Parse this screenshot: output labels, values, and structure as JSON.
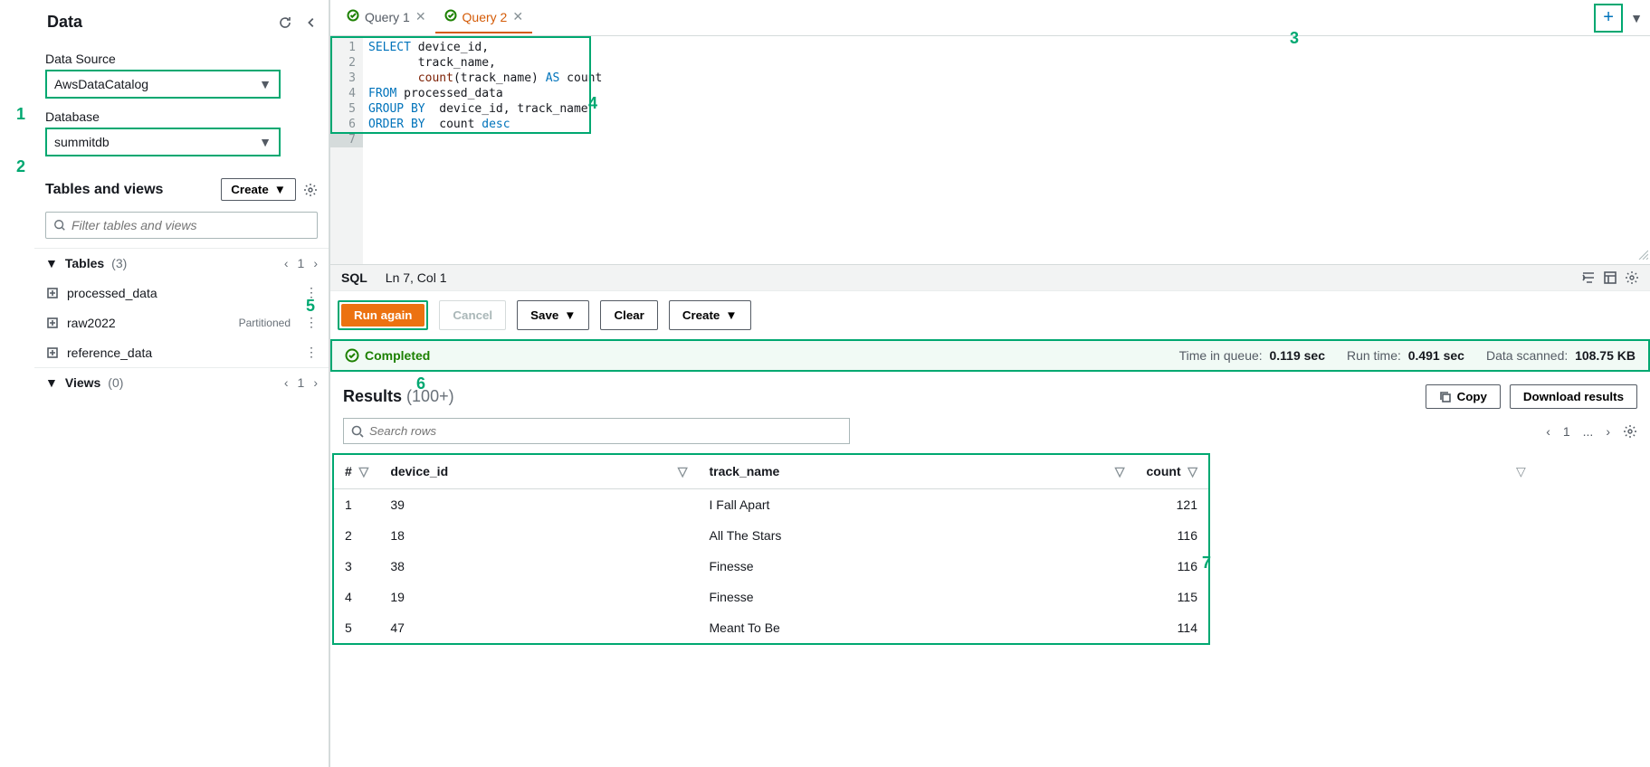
{
  "sidebar": {
    "title": "Data",
    "data_source_label": "Data Source",
    "data_source_value": "AwsDataCatalog",
    "database_label": "Database",
    "database_value": "summitdb",
    "tables_views_title": "Tables and views",
    "create_label": "Create",
    "filter_placeholder": "Filter tables and views",
    "tables_label": "Tables",
    "tables_count": "(3)",
    "tables_page": "1",
    "tables": [
      {
        "name": "processed_data",
        "badge": ""
      },
      {
        "name": "raw2022",
        "badge": "Partitioned"
      },
      {
        "name": "reference_data",
        "badge": ""
      }
    ],
    "views_label": "Views",
    "views_count": "(0)",
    "views_page": "1"
  },
  "tabs": [
    {
      "label": "Query 1",
      "active": false
    },
    {
      "label": "Query 2",
      "active": true
    }
  ],
  "editor": {
    "lines": [
      "1",
      "2",
      "3",
      "4",
      "5",
      "6",
      "7"
    ],
    "code_html": [
      {
        "segments": [
          {
            "t": "SELECT",
            "c": "kw"
          },
          {
            "t": " device_id,"
          }
        ]
      },
      {
        "segments": [
          {
            "t": "       track_name,"
          }
        ]
      },
      {
        "segments": [
          {
            "t": "       "
          },
          {
            "t": "count",
            "c": "fn"
          },
          {
            "t": "(track_name) "
          },
          {
            "t": "AS",
            "c": "kw"
          },
          {
            "t": " count"
          }
        ]
      },
      {
        "segments": [
          {
            "t": "FROM",
            "c": "kw"
          },
          {
            "t": " processed_data"
          }
        ]
      },
      {
        "segments": [
          {
            "t": "GROUP",
            "c": "kw"
          },
          {
            "t": " "
          },
          {
            "t": "BY",
            "c": "kw"
          },
          {
            "t": "  device_id, track_name"
          }
        ]
      },
      {
        "segments": [
          {
            "t": "ORDER",
            "c": "kw"
          },
          {
            "t": " "
          },
          {
            "t": "BY",
            "c": "kw"
          },
          {
            "t": "  count "
          },
          {
            "t": "desc",
            "c": "kw"
          }
        ]
      },
      {
        "segments": []
      }
    ]
  },
  "sqlbar": {
    "lang": "SQL",
    "pos": "Ln 7, Col 1"
  },
  "buttons": {
    "run": "Run again",
    "cancel": "Cancel",
    "save": "Save",
    "clear": "Clear",
    "create": "Create"
  },
  "status": {
    "label": "Completed",
    "queue_k": "Time in queue:",
    "queue_v": "0.119 sec",
    "run_k": "Run time:",
    "run_v": "0.491 sec",
    "scan_k": "Data scanned:",
    "scan_v": "108.75 KB"
  },
  "results": {
    "title": "Results",
    "count": "(100+)",
    "copy": "Copy",
    "download": "Download results",
    "search_placeholder": "Search rows",
    "page": "1",
    "ellipsis": "...",
    "columns": [
      "#",
      "device_id",
      "track_name",
      "count"
    ],
    "rows": [
      {
        "n": "1",
        "device_id": "39",
        "track_name": "I Fall Apart",
        "count": "121"
      },
      {
        "n": "2",
        "device_id": "18",
        "track_name": "All The Stars",
        "count": "116"
      },
      {
        "n": "3",
        "device_id": "38",
        "track_name": "Finesse",
        "count": "116"
      },
      {
        "n": "4",
        "device_id": "19",
        "track_name": "Finesse",
        "count": "115"
      },
      {
        "n": "5",
        "device_id": "47",
        "track_name": "Meant To Be",
        "count": "114"
      }
    ]
  },
  "callouts": {
    "c1": "1",
    "c2": "2",
    "c3": "3",
    "c4": "4",
    "c5": "5",
    "c6": "6",
    "c7": "7"
  }
}
